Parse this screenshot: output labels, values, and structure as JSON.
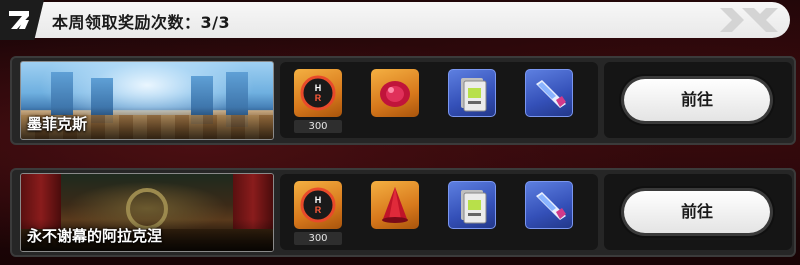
{
  "header": {
    "title": "本周领取奖励次数：3/3",
    "badge_icon": "zzz-logo-icon",
    "deco_icon": "decorative-x-icon"
  },
  "rows": [
    {
      "name": "墨菲克斯",
      "goto_label": "前往",
      "rewards": [
        {
          "icon": "hunter-coin-icon",
          "rarity": "gold",
          "quantity": "300"
        },
        {
          "icon": "red-gem-icon",
          "rarity": "gold"
        },
        {
          "icon": "data-card-icon",
          "rarity": "blue"
        },
        {
          "icon": "energy-tube-icon",
          "rarity": "blue"
        }
      ]
    },
    {
      "name": "永不谢幕的阿拉克涅",
      "goto_label": "前往",
      "rewards": [
        {
          "icon": "hunter-coin-icon",
          "rarity": "gold",
          "quantity": "300"
        },
        {
          "icon": "red-cloak-icon",
          "rarity": "gold"
        },
        {
          "icon": "data-card-icon",
          "rarity": "blue"
        },
        {
          "icon": "energy-tube-icon",
          "rarity": "blue"
        }
      ]
    }
  ],
  "colors": {
    "gold": "#e08a22",
    "blue": "#3a58c0",
    "accent_red": "#c81e32"
  }
}
